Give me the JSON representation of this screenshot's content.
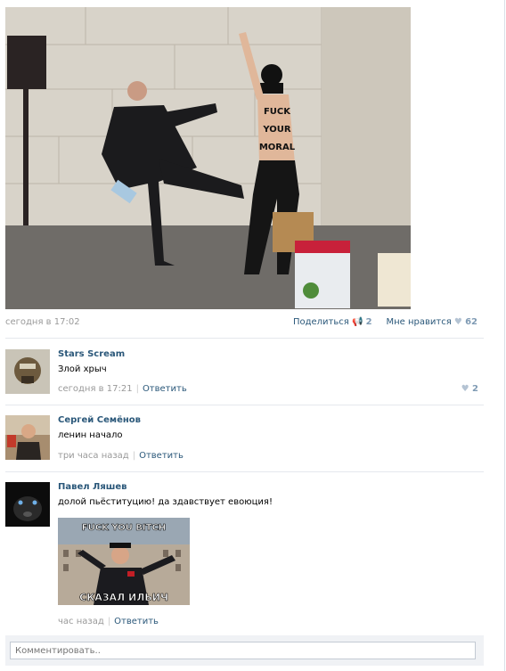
{
  "post": {
    "date": "сегодня в 17:02",
    "share_label": "Поделиться",
    "share_count": "2",
    "like_label": "Мне нравится",
    "like_count": "62",
    "photo_text": [
      "FUCK",
      "YOUR",
      "MORAL"
    ]
  },
  "comments": [
    {
      "author": "Stars Scream",
      "text": "Злой хрыч",
      "time": "сегодня в 17:21",
      "reply": "Ответить",
      "likes": "2"
    },
    {
      "author": "Сергей Семёнов",
      "text": "ленин начало",
      "time": "три часа назад",
      "reply": "Ответить"
    },
    {
      "author": "Павел Ляшев",
      "text": "долой пьёституцию! да здавствует евоюция!",
      "time": "час назад",
      "reply": "Ответить",
      "meme": {
        "top": "FUCK YOU BITCH",
        "bottom": "СКАЗАЛ ИЛЬИЧ"
      }
    }
  ],
  "composer": {
    "placeholder": "Комментировать.."
  },
  "icons": {
    "share": "megaphone-icon",
    "like": "heart-icon"
  }
}
